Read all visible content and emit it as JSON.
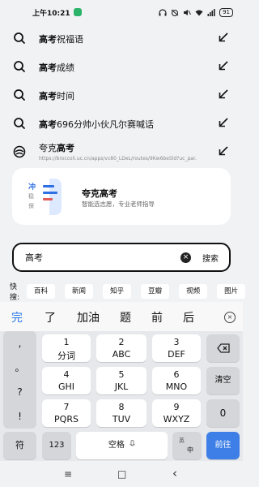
{
  "status": {
    "time": "上午10:21",
    "battery": "91"
  },
  "suggestions": [
    {
      "bold": "高考",
      "rest": "祝福语"
    },
    {
      "bold": "高考",
      "rest": "成绩"
    },
    {
      "bold": "高考",
      "rest": "时间"
    },
    {
      "bold": "高考",
      "rest": "696分帅小伙凡尔赛喊话"
    }
  ],
  "kuake": {
    "title_plain": "夸克",
    "title_bold": "高考",
    "url": "https://broccoli.uc.cn/apps/vc80_LDeL/routes/9Kw6be5ld?uc_par..."
  },
  "card": {
    "logo_chars": [
      "冲",
      "稳",
      "保"
    ],
    "title": "夸克高考",
    "subtitle": "智能选志愿，专业老师指导"
  },
  "search": {
    "value": "高考",
    "button": "搜索",
    "clear": "×"
  },
  "quick": {
    "label": "快搜:",
    "chips": [
      "百科",
      "新闻",
      "知乎",
      "豆瓣",
      "视频",
      "图片"
    ]
  },
  "candidates": [
    "完",
    "了",
    "加油",
    "题",
    "前",
    "后"
  ],
  "keyboard": {
    "symbols": [
      ",",
      "。",
      "?",
      "!"
    ],
    "rows": [
      [
        {
          "main": "1",
          "sub": "分词"
        },
        {
          "main": "2",
          "sub": "ABC"
        },
        {
          "main": "3",
          "sub": "DEF"
        }
      ],
      [
        {
          "main": "4",
          "sub": "GHI"
        },
        {
          "main": "5",
          "sub": "JKL"
        },
        {
          "main": "6",
          "sub": "MNO"
        }
      ],
      [
        {
          "main": "7",
          "sub": "PQRS"
        },
        {
          "main": "8",
          "sub": "TUV"
        },
        {
          "main": "9",
          "sub": "WXYZ"
        }
      ]
    ],
    "clear": "清空",
    "zero": "0",
    "bottom": {
      "symbol": "符",
      "num": "123",
      "space": "空格",
      "lang_top": "英",
      "lang_bottom": "中",
      "enter": "前往"
    }
  },
  "nav": {
    "menu": "≡",
    "home": "□",
    "back": "‹"
  }
}
